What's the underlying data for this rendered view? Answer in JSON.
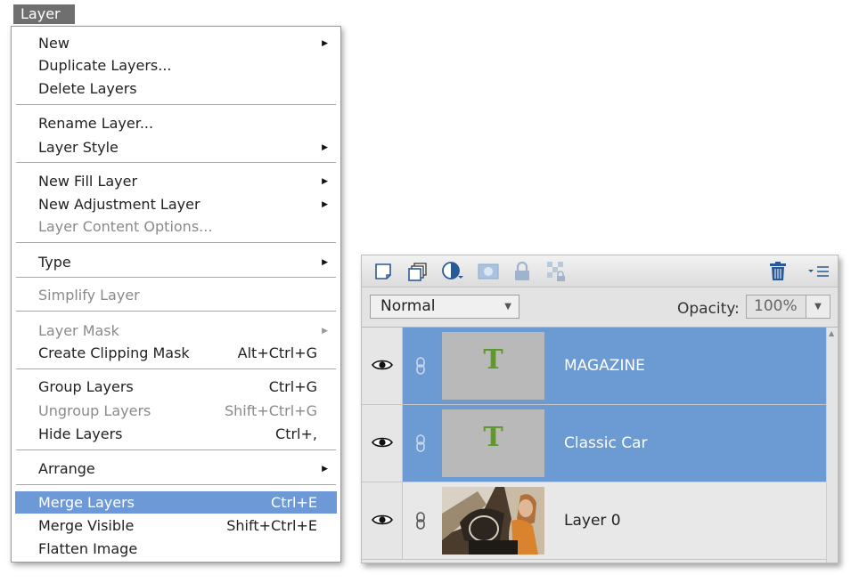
{
  "menu": {
    "title": "Layer",
    "items": [
      {
        "label": "New",
        "shortcut": "",
        "submenu": true,
        "disabled": false
      },
      {
        "label": "Duplicate Layers...",
        "shortcut": "",
        "submenu": false,
        "disabled": false
      },
      {
        "label": "Delete Layers",
        "shortcut": "",
        "submenu": false,
        "disabled": false
      },
      {
        "label": "Rename Layer...",
        "shortcut": "",
        "submenu": false,
        "disabled": false
      },
      {
        "label": "Layer Style",
        "shortcut": "",
        "submenu": true,
        "disabled": false
      },
      {
        "label": "New Fill Layer",
        "shortcut": "",
        "submenu": true,
        "disabled": false
      },
      {
        "label": "New Adjustment Layer",
        "shortcut": "",
        "submenu": true,
        "disabled": false
      },
      {
        "label": "Layer Content Options...",
        "shortcut": "",
        "submenu": false,
        "disabled": true
      },
      {
        "label": "Type",
        "shortcut": "",
        "submenu": true,
        "disabled": false
      },
      {
        "label": "Simplify Layer",
        "shortcut": "",
        "submenu": false,
        "disabled": true
      },
      {
        "label": "Layer Mask",
        "shortcut": "",
        "submenu": true,
        "disabled": true
      },
      {
        "label": "Create Clipping Mask",
        "shortcut": "Alt+Ctrl+G",
        "submenu": false,
        "disabled": false
      },
      {
        "label": "Group Layers",
        "shortcut": "Ctrl+G",
        "submenu": false,
        "disabled": false
      },
      {
        "label": "Ungroup Layers",
        "shortcut": "Shift+Ctrl+G",
        "submenu": false,
        "disabled": true
      },
      {
        "label": "Hide Layers",
        "shortcut": "Ctrl+,",
        "submenu": false,
        "disabled": false
      },
      {
        "label": "Arrange",
        "shortcut": "",
        "submenu": true,
        "disabled": false
      },
      {
        "label": "Merge Layers",
        "shortcut": "Ctrl+E",
        "submenu": false,
        "disabled": false,
        "highlighted": true
      },
      {
        "label": "Merge Visible",
        "shortcut": "Shift+Ctrl+E",
        "submenu": false,
        "disabled": false
      },
      {
        "label": "Flatten Image",
        "shortcut": "",
        "submenu": false,
        "disabled": false
      }
    ]
  },
  "panel": {
    "blend_mode": "Normal",
    "opacity_label": "Opacity:",
    "opacity_value": "100%",
    "layers": [
      {
        "name": "MAGAZINE",
        "type": "text",
        "thumb_glyph": "T",
        "selected": true
      },
      {
        "name": "Classic Car",
        "type": "text",
        "thumb_glyph": "T",
        "selected": true
      },
      {
        "name": "Layer 0",
        "type": "image",
        "thumb_glyph": "",
        "selected": false
      }
    ]
  },
  "colors": {
    "highlight": "#6d9ad6",
    "selected_layer": "#6c9ad2",
    "text_thumb_glyph": "#5d9a2a",
    "menu_title_bg": "#6f6f6f"
  }
}
